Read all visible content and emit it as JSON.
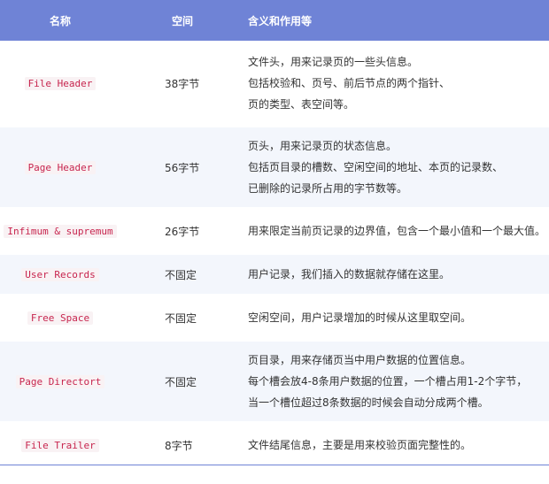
{
  "header": {
    "col_name": "名称",
    "col_space": "空间",
    "col_desc": "含义和作用等"
  },
  "rows": [
    {
      "name": "File Header",
      "space": "38字节",
      "desc": [
        "文件头，用来记录页的一些头信息。",
        "包括校验和、页号、前后节点的两个指针、",
        "页的类型、表空间等。"
      ]
    },
    {
      "name": "Page Header",
      "space": "56字节",
      "desc": [
        "页头，用来记录页的状态信息。",
        "包括页目录的槽数、空闲空间的地址、本页的记录数、",
        "已删除的记录所占用的字节数等。"
      ]
    },
    {
      "name": "Infimum & supremum",
      "space": "26字节",
      "desc": [
        "用来限定当前页记录的边界值，包含一个最小值和一个最大值。"
      ]
    },
    {
      "name": "User Records",
      "space": "不固定",
      "desc": [
        "用户记录，我们插入的数据就存储在这里。"
      ]
    },
    {
      "name": "Free Space",
      "space": "不固定",
      "desc": [
        "空闲空间，用户记录增加的时候从这里取空间。"
      ]
    },
    {
      "name": "Page Directort",
      "space": "不固定",
      "desc": [
        "页目录，用来存储页当中用户数据的位置信息。",
        "每个槽会放4-8条用户数据的位置，一个槽占用1-2个字节，",
        "当一个槽位超过8条数据的时候会自动分成两个槽。"
      ]
    },
    {
      "name": "File Trailer",
      "space": "8字节",
      "desc": [
        "文件结尾信息，主要是用来校验页面完整性的。"
      ]
    }
  ]
}
